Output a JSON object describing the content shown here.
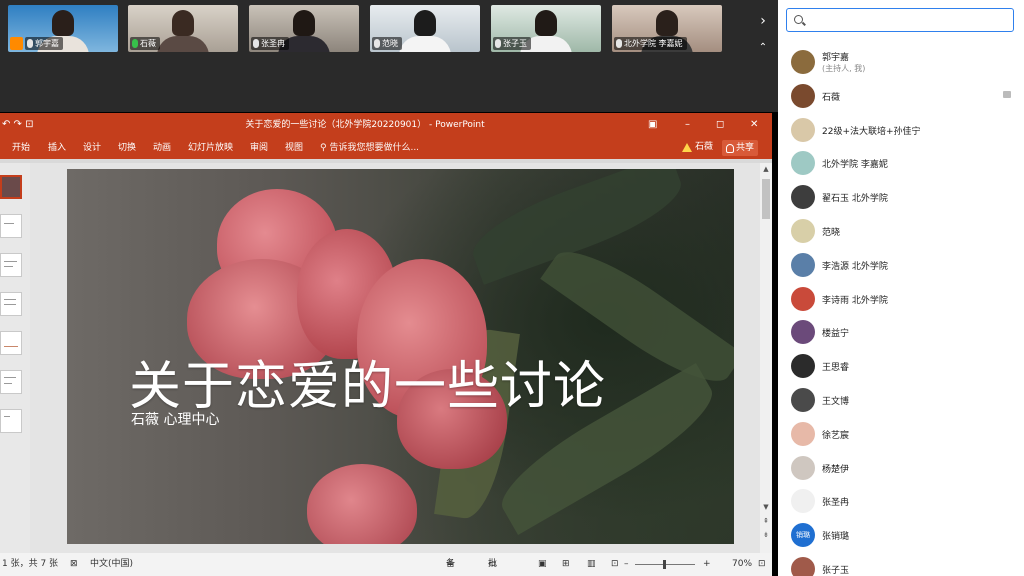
{
  "video_strip": {
    "tiles": [
      {
        "name": "郭宇嘉",
        "host": true
      },
      {
        "name": "石薇",
        "host": false
      },
      {
        "name": "张圣冉",
        "host": false
      },
      {
        "name": "范晓",
        "host": false
      },
      {
        "name": "张子玉",
        "host": false
      },
      {
        "name": "北外学院 李嘉妮",
        "host": false
      }
    ],
    "next_icon": "chevron-right-icon",
    "collapse_icon": "chevron-up-icon"
  },
  "ppt": {
    "window_title": "关于恋爱的一些讨论（北外学院20220901） - PowerPoint",
    "quick_access": "↶ ↷ ⊡",
    "tabs": [
      "开始",
      "插入",
      "设计",
      "切换",
      "动画",
      "幻灯片放映",
      "审阅",
      "视图"
    ],
    "tell_me": "告诉我您想要做什么...",
    "user": "石薇",
    "share": "共享",
    "slide": {
      "title": "关于恋爱的一些讨论",
      "subtitle": "石薇  心理中心"
    },
    "status": {
      "slide_info": "1 张，共 7 张",
      "language": "中文(中国)",
      "notes": "备注",
      "comments": "批注",
      "zoom": "70%"
    }
  },
  "panel": {
    "search": {
      "value": "",
      "placeholder": ""
    },
    "participants": [
      {
        "name": "郭宇嘉",
        "sub": "(主持人, 我)",
        "avatar_color": "#8b6b3d"
      },
      {
        "name": "石薇",
        "sub": "",
        "avatar_color": "#7a4a2e",
        "chat": true
      },
      {
        "name": "22级+法大联培+孙佳宁",
        "sub": "",
        "avatar_color": "#d9c8a8"
      },
      {
        "name": "北外学院 李嘉妮",
        "sub": "",
        "avatar_color": "#9ec9c4"
      },
      {
        "name": "翟石玉 北外学院",
        "sub": "",
        "avatar_color": "#3d3d3d"
      },
      {
        "name": "范晓",
        "sub": "",
        "avatar_color": "#d8cfa8"
      },
      {
        "name": "李浩源 北外学院",
        "sub": "",
        "avatar_color": "#5a7fa8"
      },
      {
        "name": "李诗雨 北外学院",
        "sub": "",
        "avatar_color": "#c94a3a"
      },
      {
        "name": "楼益宁",
        "sub": "",
        "avatar_color": "#6b4a7a"
      },
      {
        "name": "王思睿",
        "sub": "",
        "avatar_color": "#2b2b2b"
      },
      {
        "name": "王文博",
        "sub": "",
        "avatar_color": "#4a4a4a"
      },
      {
        "name": "徐艺宸",
        "sub": "",
        "avatar_color": "#e7b9a8"
      },
      {
        "name": "杨楚伊",
        "sub": "",
        "avatar_color": "#cfc7c0"
      },
      {
        "name": "张圣冉",
        "sub": "",
        "avatar_color": "#f0f0f0"
      },
      {
        "name": "张销璐",
        "sub": "",
        "avatar_color": "#1f6fd1",
        "avatar_text": "销璐"
      },
      {
        "name": "张子玉",
        "sub": "",
        "avatar_color": "#a05a4a"
      }
    ]
  }
}
